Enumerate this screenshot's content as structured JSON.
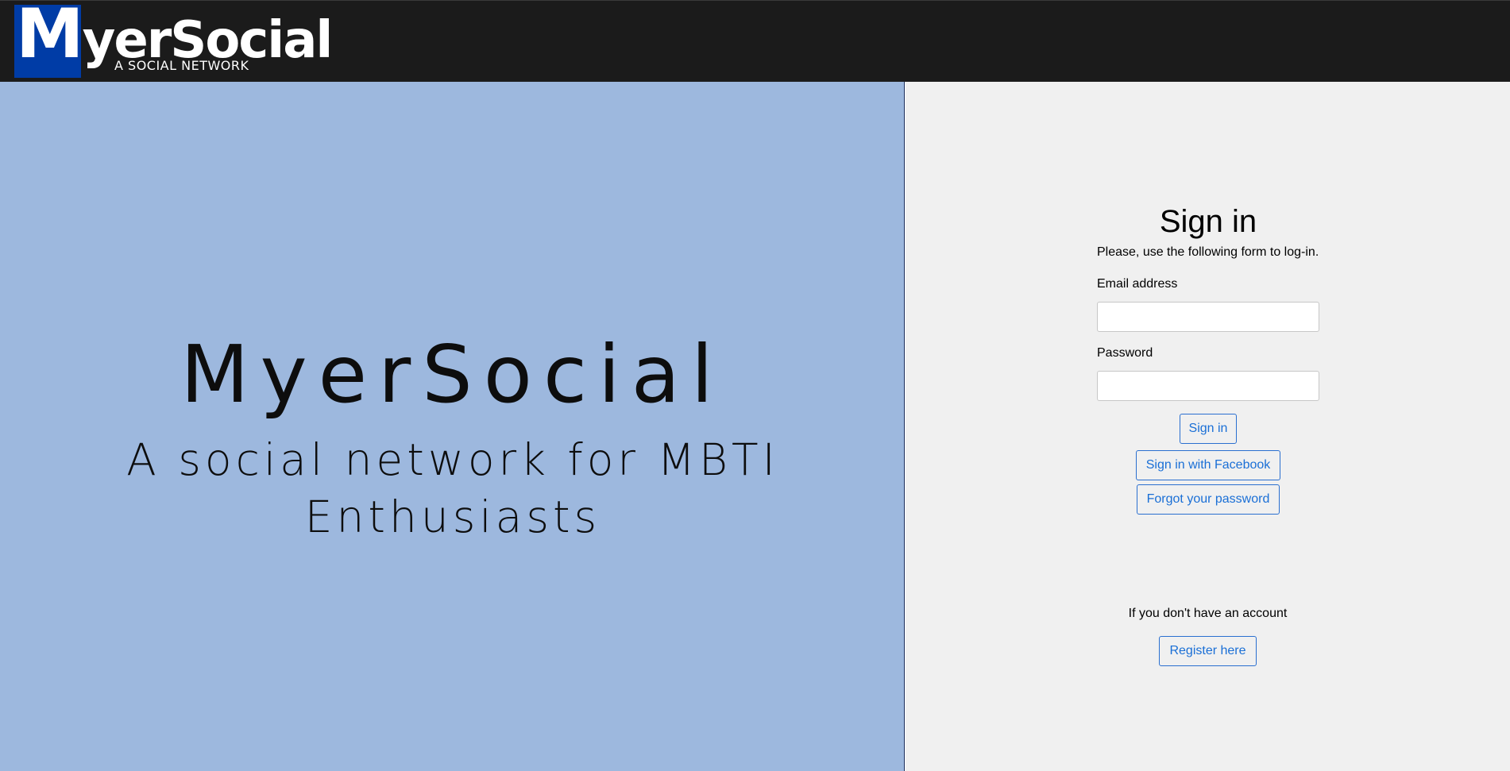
{
  "header": {
    "logo_initial": "M",
    "logo_rest": "yerSocial",
    "logo_tagline": "A SOCIAL NETWORK",
    "bg_color": "#1b1b1b",
    "logo_block_color": "#003ca6"
  },
  "hero": {
    "title": "MyerSocial",
    "subtitle": "A social network for MBTI Enthusiasts",
    "bg_color": "#9db8de"
  },
  "signin": {
    "title": "Sign in",
    "intro": "Please, use the following form to log-in.",
    "email_label": "Email address",
    "email_value": "",
    "password_label": "Password",
    "password_value": "",
    "signin_button": "Sign in",
    "facebook_button": "Sign in with Facebook",
    "forgot_button": "Forgot your password",
    "accent_color": "#1a6fd6"
  },
  "register": {
    "prompt": "If you don't have an account",
    "button": "Register here"
  }
}
